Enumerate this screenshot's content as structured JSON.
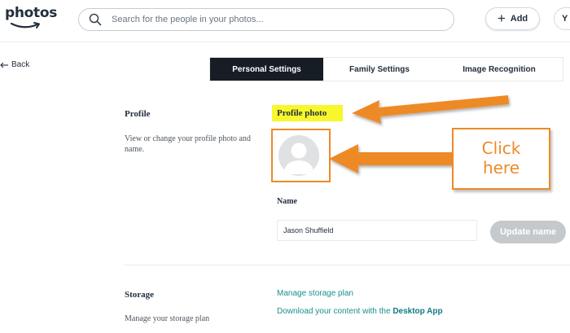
{
  "header": {
    "logo_text": "photos",
    "search_placeholder": "Search for the people in your photos...",
    "add_label": "Add",
    "account_initial": "Y"
  },
  "nav": {
    "back_label": "Back"
  },
  "tabs": [
    {
      "label": "Personal Settings",
      "active": true
    },
    {
      "label": "Family Settings",
      "active": false
    },
    {
      "label": "Image Recognition",
      "active": false
    }
  ],
  "profile": {
    "title": "Profile",
    "description": "View or change your profile photo and name.",
    "photo_label": "Profile photo",
    "name_label": "Name",
    "name_value": "Jason Shuffield",
    "update_button": "Update name"
  },
  "storage": {
    "title": "Storage",
    "description": "Manage your storage plan",
    "manage_link": "Manage storage plan",
    "download_text": "Download your content with the ",
    "download_app": "Desktop App"
  },
  "annotation": {
    "callout_line1": "Click",
    "callout_line2": "here"
  },
  "colors": {
    "accent_orange": "#ee8a28",
    "highlight_yellow": "#f7f72b",
    "active_tab": "#161d25",
    "link_teal": "#188f8e"
  }
}
